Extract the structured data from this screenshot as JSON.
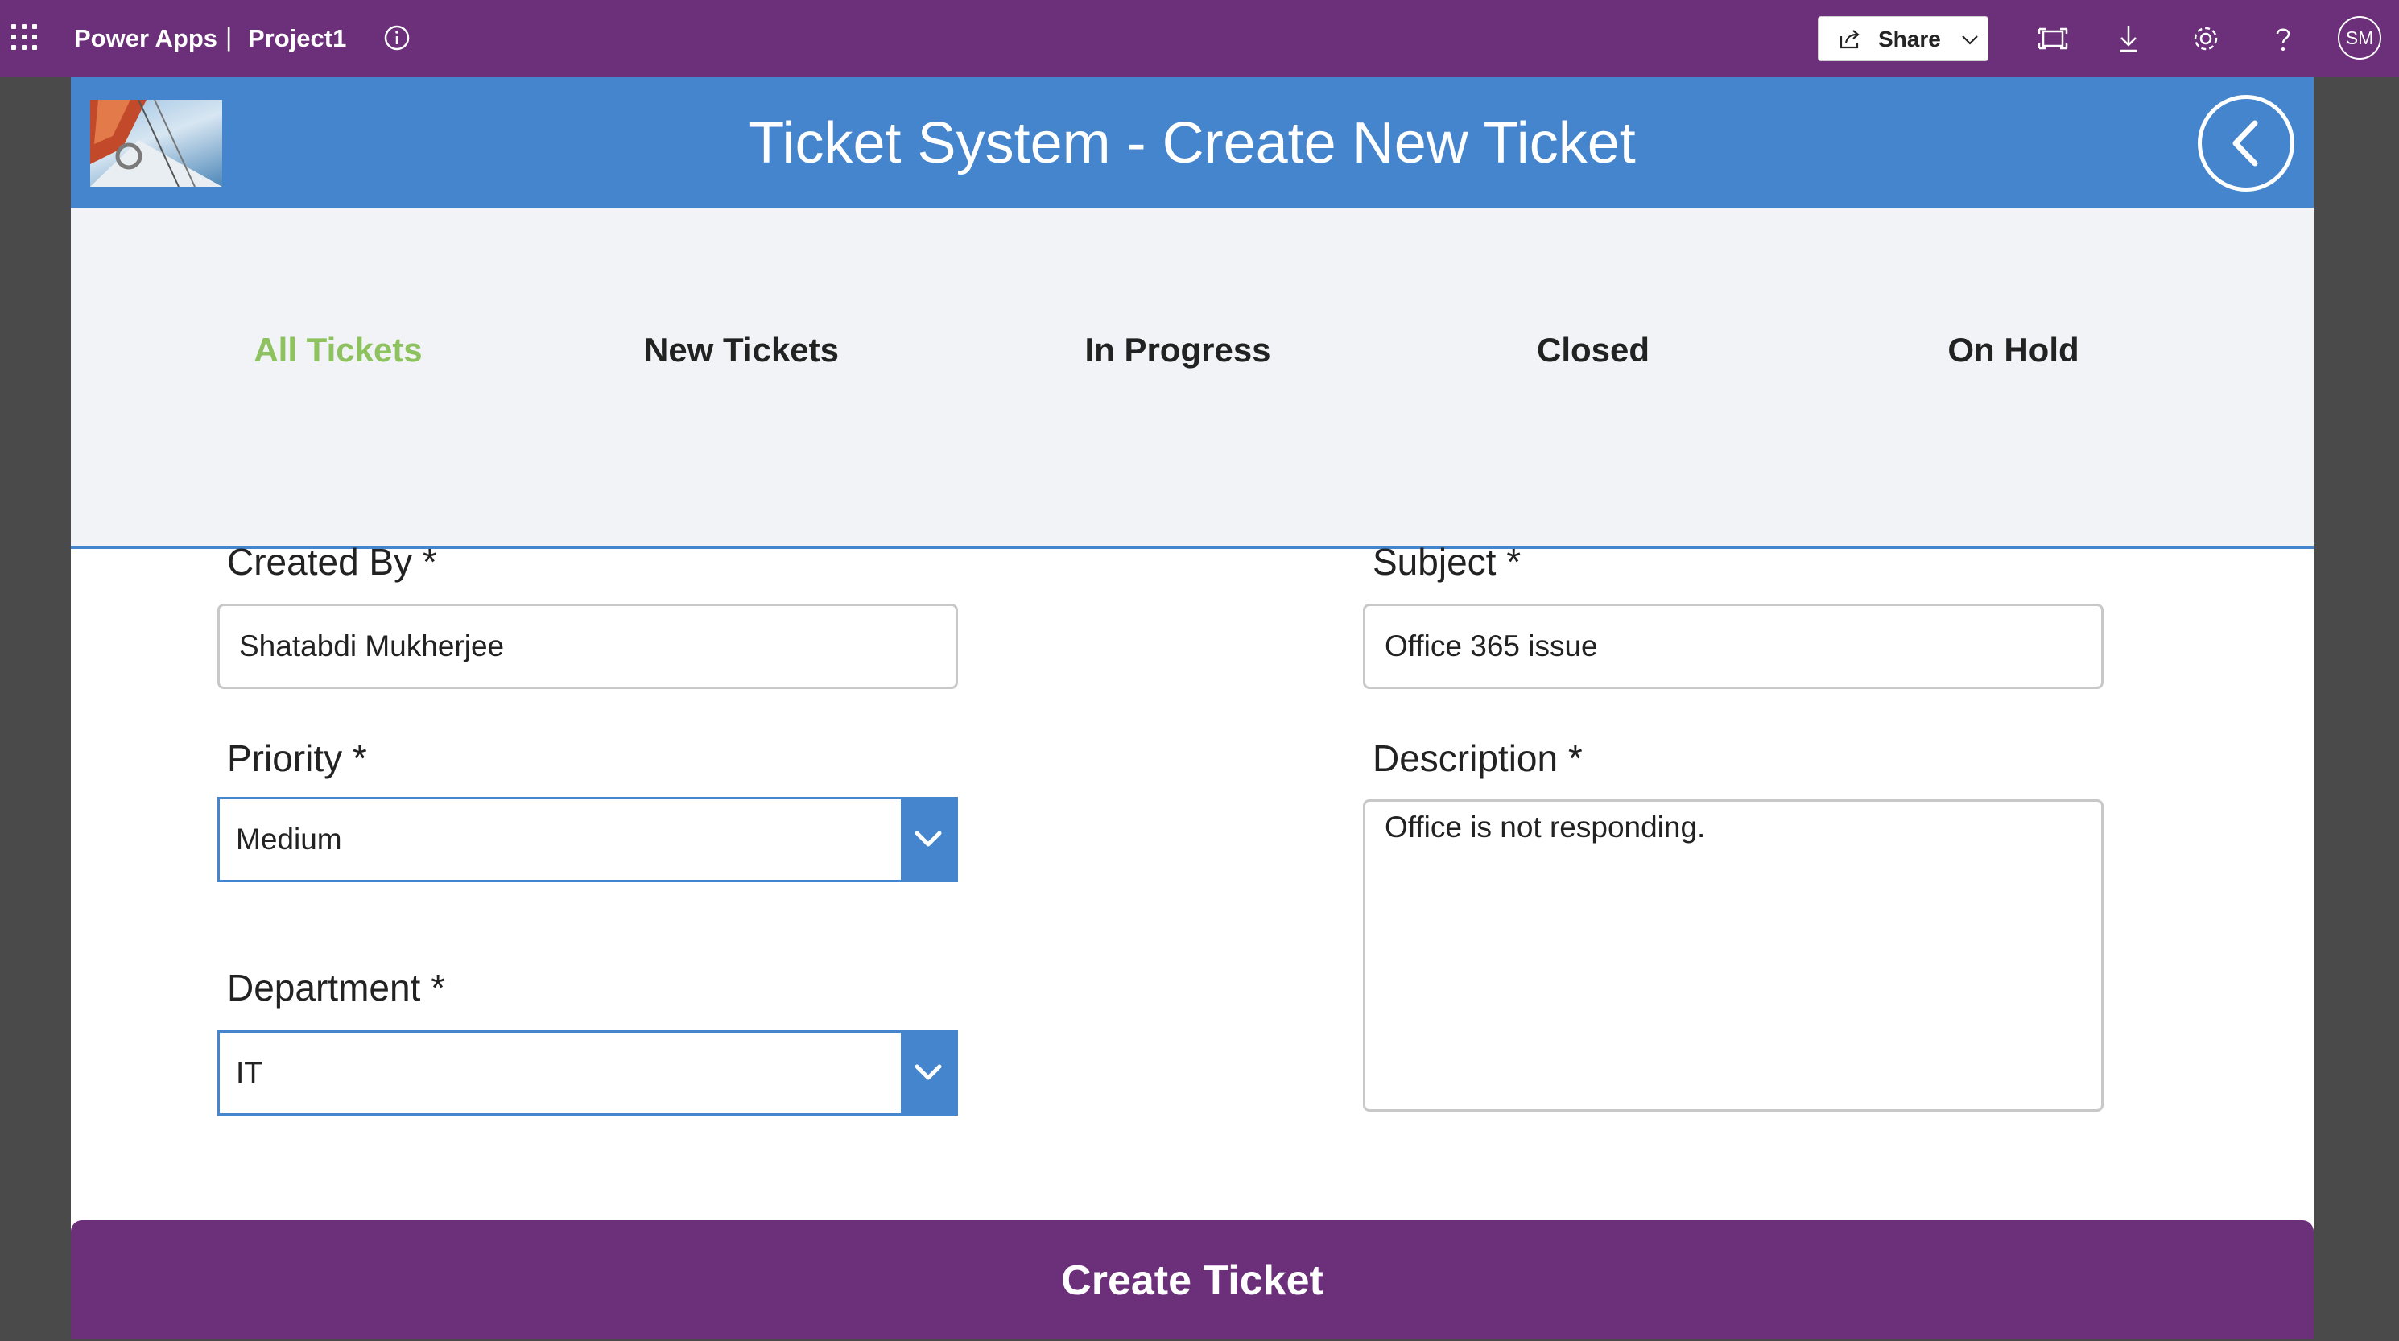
{
  "suite_bar": {
    "app_name": "Power Apps",
    "separator": "|",
    "project": "Project1",
    "share_label": "Share",
    "avatar_initials": "SM"
  },
  "header": {
    "title": "Ticket System - Create New Ticket"
  },
  "tabs": [
    {
      "label": "All Tickets",
      "active": true
    },
    {
      "label": "New Tickets",
      "active": false
    },
    {
      "label": "In Progress",
      "active": false
    },
    {
      "label": "Closed",
      "active": false
    },
    {
      "label": "On Hold",
      "active": false
    }
  ],
  "form": {
    "created_by": {
      "label": "Created By *",
      "value": "Shatabdi Mukherjee"
    },
    "priority": {
      "label": "Priority *",
      "value": "Medium"
    },
    "department": {
      "label": "Department *",
      "value": "IT"
    },
    "subject": {
      "label": "Subject *",
      "value": "Office 365 issue"
    },
    "description": {
      "label": "Description *",
      "value": "Office is not responding."
    }
  },
  "actions": {
    "create_label": "Create Ticket"
  },
  "colors": {
    "suite_bar": "#6c2f7a",
    "header": "#4485cd",
    "active_tab": "#8dc25f",
    "tab_bar_bg": "#f1f3f7"
  },
  "icons": [
    "waffle-icon",
    "info-icon",
    "share-icon",
    "chevron-down-icon",
    "fit-screen-icon",
    "download-icon",
    "gear-icon",
    "help-icon",
    "back-arrow-icon",
    "dropdown-chevron-icon"
  ]
}
